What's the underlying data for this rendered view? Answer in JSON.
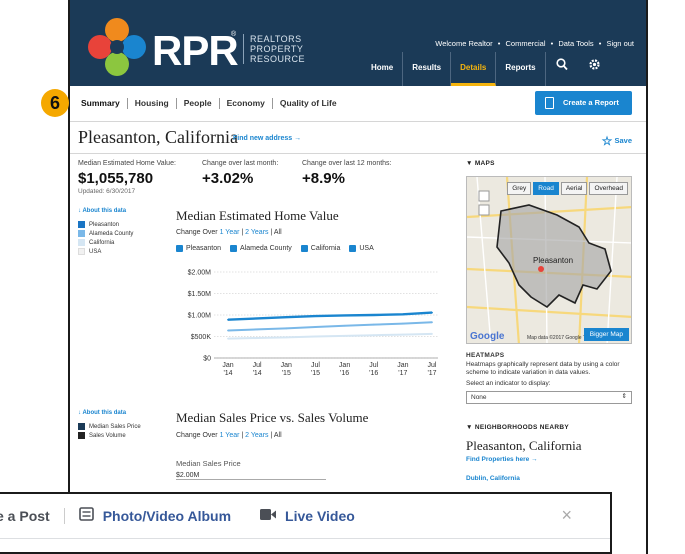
{
  "header": {
    "brand": "RPR",
    "brand_reg": "®",
    "brand_sub_1": "REALTORS",
    "brand_sub_2": "PROPERTY",
    "brand_sub_3": "RESOURCE",
    "welcome": "Welcome Realtor",
    "commercial": "Commercial",
    "data_tools": "Data Tools",
    "sign_out": "Sign out",
    "sep": "•",
    "nav": [
      "Home",
      "Results",
      "Details",
      "Reports"
    ],
    "active_nav": "Details"
  },
  "step_badge": "6",
  "tabs": [
    "Summary",
    "Housing",
    "People",
    "Economy",
    "Quality of Life"
  ],
  "create_report": "Create a Report",
  "title": {
    "city": "Pleasanton, California",
    "find_link": "Find new address →",
    "save": "Save"
  },
  "stats": [
    {
      "label": "Median Estimated Home Value:",
      "value": "$1,055,780",
      "updated": "Updated: 6/30/2017"
    },
    {
      "label": "Change over last month:",
      "value": "+3.02%"
    },
    {
      "label": "Change over last 12 months:",
      "value": "+8.9%"
    }
  ],
  "about_data": "↓ About this data",
  "legend1": [
    {
      "label": "Pleasanton",
      "color": "#1a75c4"
    },
    {
      "label": "Alameda County",
      "color": "#7ab8e8"
    },
    {
      "label": "California",
      "color": "#d5e6f3"
    },
    {
      "label": "USA",
      "color": "#f1f1f1"
    }
  ],
  "chart1": {
    "title": "Median Estimated Home Value",
    "change_over": "Change Over",
    "one_year": "1 Year",
    "two_years": "2 Years",
    "all": "All",
    "bar": " | "
  },
  "checks": [
    "Pleasanton",
    "Alameda County",
    "California",
    "USA"
  ],
  "chart_data": {
    "type": "line",
    "title": "Median Estimated Home Value",
    "x": [
      "Jan '14",
      "Jul '14",
      "Jan '15",
      "Jul '15",
      "Jan '16",
      "Jul '16",
      "Jan '17",
      "Jul '17"
    ],
    "x_top": [
      "Jan",
      "Jul",
      "Jan",
      "Jul",
      "Jan",
      "Jul",
      "Jan",
      "Jul"
    ],
    "x_bottom": [
      "'14",
      "'14",
      "'15",
      "'15",
      "'16",
      "'16",
      "'17",
      "'17"
    ],
    "y_ticks": [
      "$2.00M",
      "$1.50M",
      "$1.00M",
      "$500K",
      "$0"
    ],
    "ylim": [
      0,
      2000000
    ],
    "series": [
      {
        "name": "Pleasanton",
        "values": [
          890000,
          920000,
          950000,
          975000,
          990000,
          1000000,
          1015000,
          1055780
        ],
        "color": "#1a85cf"
      },
      {
        "name": "Alameda County",
        "values": [
          640000,
          665000,
          690000,
          720000,
          750000,
          775000,
          800000,
          830000
        ],
        "color": "#7ab8e8"
      },
      {
        "name": "California",
        "values": [
          450000,
          465000,
          480000,
          500000,
          515000,
          530000,
          545000,
          560000
        ],
        "color": "#d5e6f3"
      }
    ]
  },
  "legend2": [
    {
      "label": "Median Sales Price",
      "color": "#1b3a57"
    },
    {
      "label": "Sales Volume",
      "color": "#222222"
    }
  ],
  "chart2": {
    "title": "Median Sales Price vs. Sales Volume",
    "axis_label": "Median Sales Price",
    "tick": "$2.00M"
  },
  "maps": {
    "heading": "▼ MAPS",
    "buttons": [
      "Grey",
      "Road",
      "Aerial",
      "Overhead"
    ],
    "active": "Road",
    "bigger": "Bigger Map",
    "google": "Google",
    "map_data": "Map data ©2017 Google   Terms of Use",
    "place_label": "Pleasanton"
  },
  "heatmaps": {
    "heading": "HEATMAPS",
    "desc": "Heatmaps graphically represent data by using a color scheme to indicate variation in data values.",
    "select_label": "Select an indicator to display:",
    "select_value": "None"
  },
  "neighborhoods": {
    "heading": "▼ NEIGHBORHOODS NEARBY",
    "city": "Pleasanton, California",
    "find": "Find Properties here →",
    "dublin": "Dublin, California"
  },
  "facebook": {
    "post": "e a Post",
    "album": "Photo/Video Album",
    "live": "Live Video",
    "close": "×"
  }
}
